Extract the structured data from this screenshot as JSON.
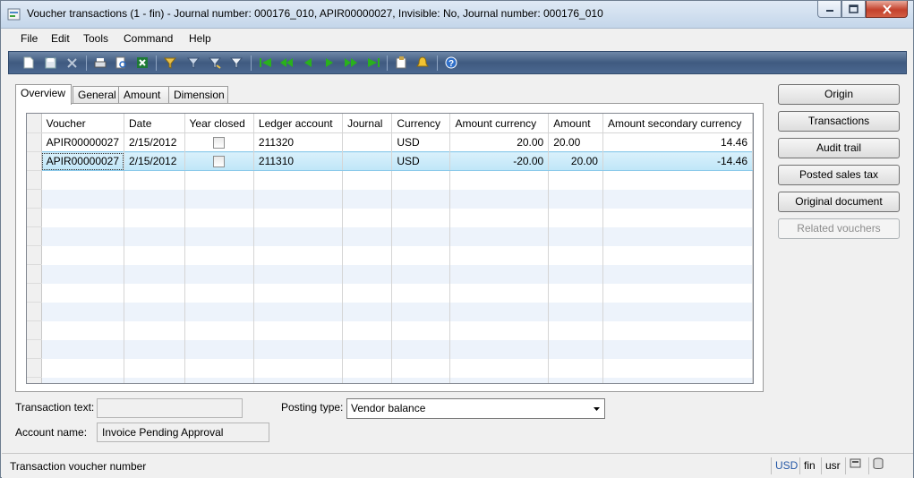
{
  "window": {
    "title": "Voucher transactions (1 - fin) - Journal number: 000176_010, APIR00000027, Invisible: No, Journal number: 000176_010"
  },
  "menu": [
    "File",
    "Edit",
    "Tools",
    "Command",
    "Help"
  ],
  "tabs": [
    "Overview",
    "General",
    "Amount",
    "Dimension"
  ],
  "grid": {
    "columns": [
      "Voucher",
      "Date",
      "Year closed",
      "Ledger account",
      "Journal",
      "Currency",
      "Amount currency",
      "Amount",
      "Amount secondary currency"
    ],
    "rows": [
      {
        "voucher": "APIR00000027",
        "date": "2/15/2012",
        "year_closed": false,
        "ledger_account": "211320",
        "journal": "",
        "currency": "USD",
        "amount_currency": "20.00",
        "amount": "20.00",
        "amount_secondary": "14.46"
      },
      {
        "voucher": "APIR00000027",
        "date": "2/15/2012",
        "year_closed": false,
        "ledger_account": "211310",
        "journal": "",
        "currency": "USD",
        "amount_currency": "-20.00",
        "amount": "20.00",
        "amount_secondary": "-14.46"
      }
    ]
  },
  "side_buttons": [
    "Origin",
    "Transactions",
    "Audit trail",
    "Posted sales tax",
    "Original document",
    "Related vouchers"
  ],
  "form": {
    "transaction_text_label": "Transaction text:",
    "transaction_text_value": "",
    "posting_type_label": "Posting type:",
    "posting_type_value": "Vendor balance",
    "account_name_label": "Account name:",
    "account_name_value": "Invoice Pending Approval"
  },
  "status": {
    "text": "Transaction voucher number",
    "currency": "USD",
    "company": "fin",
    "user": "usr"
  },
  "icons": {
    "toolbar": [
      "new-icon",
      "save-icon",
      "delete-icon",
      "print-icon",
      "print-preview-icon",
      "export-excel-icon",
      "filter-by-selection-icon",
      "filter-by-grid-icon",
      "advanced-filter-icon",
      "remove-filter-icon",
      "first-record-icon",
      "previous-page-icon",
      "previous-record-icon",
      "next-record-icon",
      "next-page-icon",
      "last-record-icon",
      "document-handling-icon",
      "alert-icon",
      "help-icon"
    ]
  },
  "colors": {
    "toolbar": "#4b6890",
    "selected_row": "#bfe6f8",
    "alt_row": "#edf3fb",
    "nav_green": "#29b11c"
  }
}
